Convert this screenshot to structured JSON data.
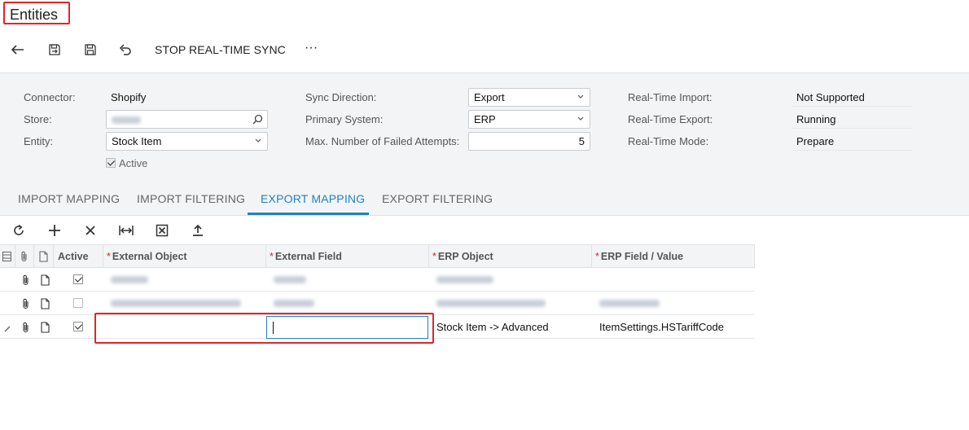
{
  "page": {
    "title": "Entities"
  },
  "toolbar": {
    "stop_sync_label": "STOP REAL-TIME SYNC",
    "more_label": "···"
  },
  "form": {
    "connector": {
      "label": "Connector:",
      "value": "Shopify"
    },
    "store": {
      "label": "Store:",
      "value": ""
    },
    "entity": {
      "label": "Entity:",
      "value": "Stock Item"
    },
    "active": {
      "label": "Active",
      "checked": true
    },
    "sync_direction": {
      "label": "Sync Direction:",
      "value": "Export"
    },
    "primary_system": {
      "label": "Primary System:",
      "value": "ERP"
    },
    "max_failed": {
      "label": "Max. Number of Failed Attempts:",
      "value": "5"
    },
    "rt_import": {
      "label": "Real-Time Import:",
      "value": "Not Supported"
    },
    "rt_export": {
      "label": "Real-Time Export:",
      "value": "Running"
    },
    "rt_mode": {
      "label": "Real-Time Mode:",
      "value": "Prepare"
    }
  },
  "tabs": [
    {
      "label": "IMPORT MAPPING",
      "active": false
    },
    {
      "label": "IMPORT FILTERING",
      "active": false
    },
    {
      "label": "EXPORT MAPPING",
      "active": true
    },
    {
      "label": "EXPORT FILTERING",
      "active": false
    }
  ],
  "grid": {
    "columns": {
      "active": "Active",
      "external_object": "External Object",
      "external_field": "External Field",
      "erp_object": "ERP Object",
      "erp_field": "ERP Field / Value"
    },
    "rows": [
      {
        "active": true,
        "external_object": "",
        "external_field": "",
        "erp_object": "",
        "erp_field": ""
      },
      {
        "active": false,
        "external_object": "",
        "external_field": "",
        "erp_object": "",
        "erp_field": ""
      },
      {
        "active": true,
        "external_object": "",
        "external_field": "",
        "erp_object": "Stock Item -> Advanced",
        "erp_field": "ItemSettings.HSTariffCode"
      }
    ]
  },
  "colors": {
    "accent": "#1f82c4",
    "highlight_red": "#e0252a",
    "required": "#d0262c"
  }
}
